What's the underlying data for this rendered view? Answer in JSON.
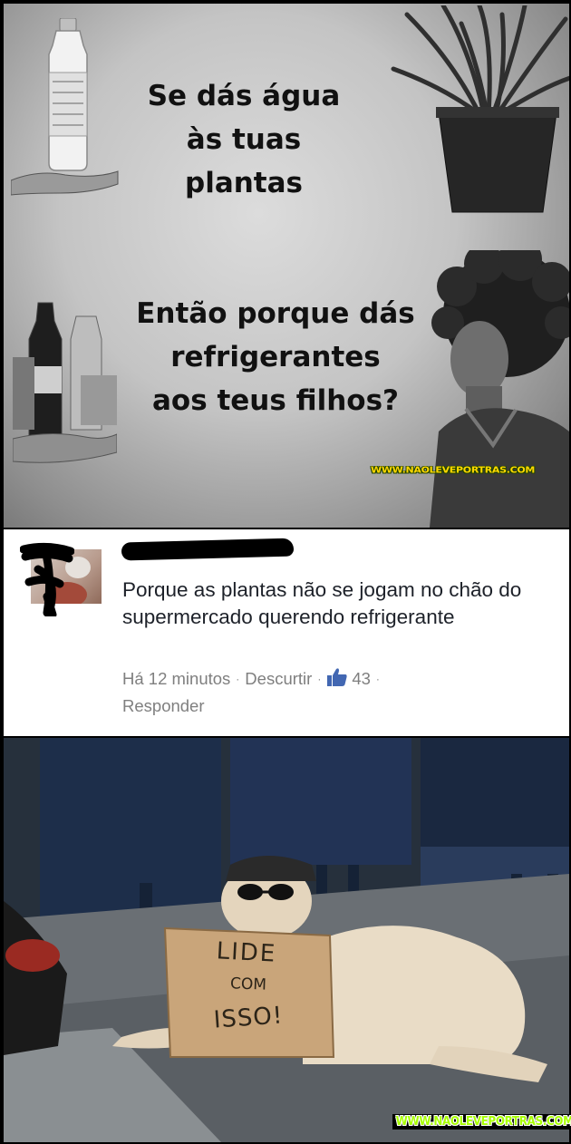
{
  "meme": {
    "line1": [
      "Se dás água",
      "às tuas plantas"
    ],
    "line2": [
      "Então porque dás",
      "refrigerantes",
      "aos teus filhos?"
    ],
    "watermark": "WWW.NAOLEVEPORTRAS.COM"
  },
  "comment": {
    "text": "Porque as plantas não se jogam no chão do supermercado querendo refrigerante",
    "time": "Há 12 minutos",
    "action_unlike": "Descurtir",
    "like_count": "43",
    "action_reply": "Responder",
    "separator": "·",
    "like_icon": "thumbs-up-icon",
    "like_color": "#4267b2"
  },
  "photo": {
    "sign_lines": [
      "LIDE",
      "COM",
      "ISSO!"
    ]
  },
  "footer": {
    "watermark": "WWW.NAOLEVEPORTRAS.COM"
  }
}
